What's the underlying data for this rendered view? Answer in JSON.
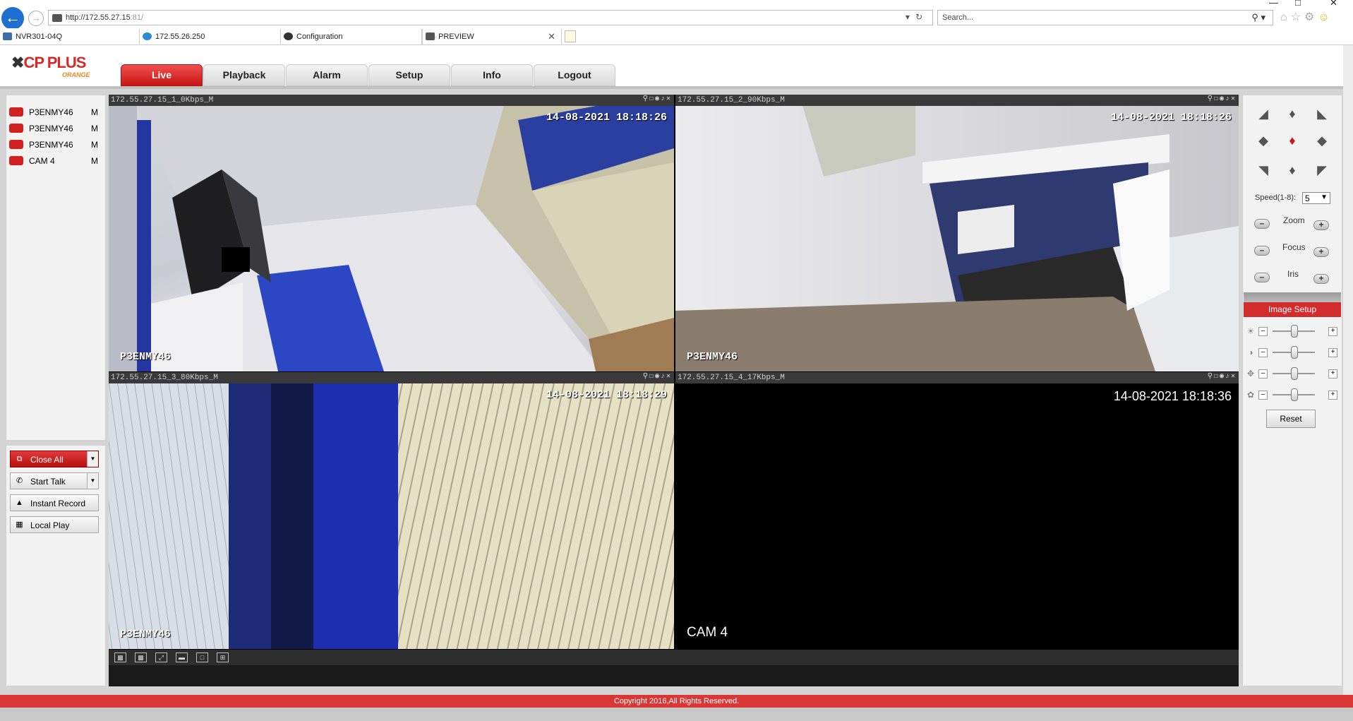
{
  "browser": {
    "url_host": "http://172.55.27.15",
    "url_rest": ":81/",
    "search_placeholder": "Search...",
    "tabs": [
      {
        "label": "NVR301-04Q"
      },
      {
        "label": "172.55.26.250"
      },
      {
        "label": "Configuration"
      },
      {
        "label": "PREVIEW"
      }
    ]
  },
  "app": {
    "logo_text": "CP PLUS",
    "logo_sub": "ORANGE",
    "nav": [
      {
        "label": "Live"
      },
      {
        "label": "Playback"
      },
      {
        "label": "Alarm"
      },
      {
        "label": "Setup"
      },
      {
        "label": "Info"
      },
      {
        "label": "Logout"
      }
    ],
    "active_nav": "Live"
  },
  "camera_list": [
    {
      "name": "P3ENMY46",
      "mode": "M"
    },
    {
      "name": "P3ENMY46",
      "mode": "M"
    },
    {
      "name": "P3ENMY46",
      "mode": "M"
    },
    {
      "name": "CAM 4",
      "mode": "M"
    }
  ],
  "left_buttons": {
    "close_all": "Close All",
    "start_talk": "Start Talk",
    "instant_record": "Instant Record",
    "local_play": "Local Play"
  },
  "panes": [
    {
      "header": "172.55.27.15_1_0Kbps_M",
      "timestamp": "14-08-2021 18:18:26",
      "name": "P3ENMY46"
    },
    {
      "header": "172.55.27.15_2_90Kbps_M",
      "timestamp": "14-08-2021 18:18:26",
      "name": "P3ENMY46"
    },
    {
      "header": "172.55.27.15_3_80Kbps_M",
      "timestamp": "14-08-2021 18:18:29",
      "name": "P3ENMY46"
    },
    {
      "header": "172.55.27.15_4_17Kbps_M",
      "timestamp": "14-08-2021 18:18:36",
      "name": "CAM 4"
    }
  ],
  "ptz": {
    "speed_label": "Speed(1-8):",
    "speed_value": "5",
    "zoom_label": "Zoom",
    "focus_label": "Focus",
    "iris_label": "Iris"
  },
  "image_setup": {
    "title": "Image Setup",
    "reset_label": "Reset",
    "sliders": [
      "brightness-icon",
      "contrast-icon",
      "saturation-icon",
      "hue-icon"
    ]
  },
  "footer": {
    "copyright": "Copyright 2016,All Rights Reserved."
  },
  "colors": {
    "accent": "#d32c2c",
    "selected_pane": "#22b022"
  }
}
